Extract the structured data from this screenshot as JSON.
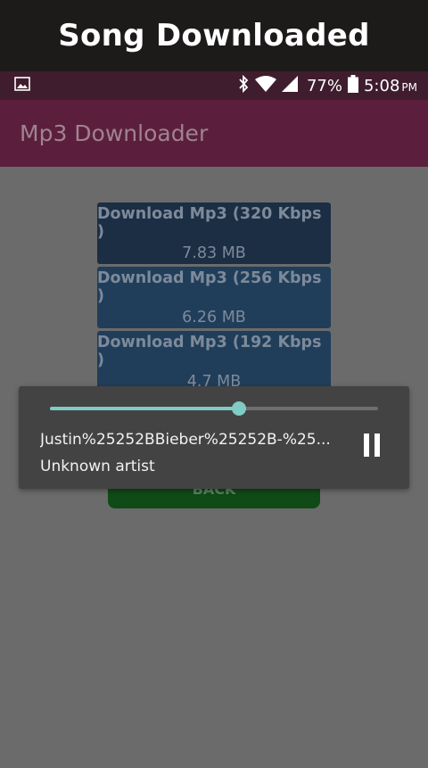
{
  "banner": {
    "title": "Song Downloaded"
  },
  "status_bar": {
    "notification_icon": "image-icon",
    "bluetooth_icon": "bluetooth-icon",
    "wifi_icon": "wifi-icon",
    "signal_icon": "signal-icon",
    "battery_percent": "77%",
    "battery_icon": "battery-icon",
    "time": "5:08",
    "ampm": "PM"
  },
  "app_bar": {
    "title": "Mp3 Downloader"
  },
  "downloads": [
    {
      "label": "Download Mp3 (320 Kbps )",
      "size": "7.83 MB"
    },
    {
      "label": "Download Mp3 (256 Kbps )",
      "size": "6.26 MB"
    },
    {
      "label": "Download Mp3 (192 Kbps )",
      "size": "4.7 MB"
    }
  ],
  "back_button": {
    "label": "BACK"
  },
  "player": {
    "title": "Justin%25252BBieber%25252B-%25...",
    "artist": "Unknown artist",
    "progress": 0.575,
    "pause_icon": "pause-icon"
  },
  "colors": {
    "accent": "#80cbc4",
    "app_bar": "#5b1f3d",
    "status_bar": "#3f1d2e",
    "back_button": "#0f4a17"
  }
}
